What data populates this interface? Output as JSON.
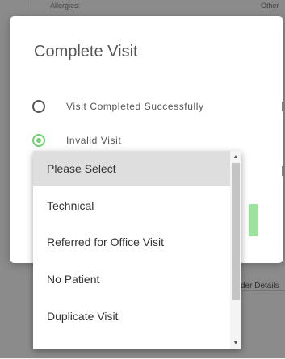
{
  "background": {
    "top_left_label": "Allergies:",
    "top_right_label": "Other",
    "right_text": "der Details"
  },
  "modal": {
    "title": "Complete Visit",
    "options": [
      {
        "label": "Visit Completed Successfully",
        "checked": false
      },
      {
        "label": "Invalid Visit",
        "checked": true
      }
    ]
  },
  "dropdown": {
    "selected": "Please Select",
    "items": [
      "Please Select",
      "Technical",
      "Referred for Office Visit",
      "No Patient",
      "Duplicate Visit"
    ]
  },
  "colors": {
    "accent_green": "#6fd16f",
    "selected_bg": "#dedede"
  }
}
